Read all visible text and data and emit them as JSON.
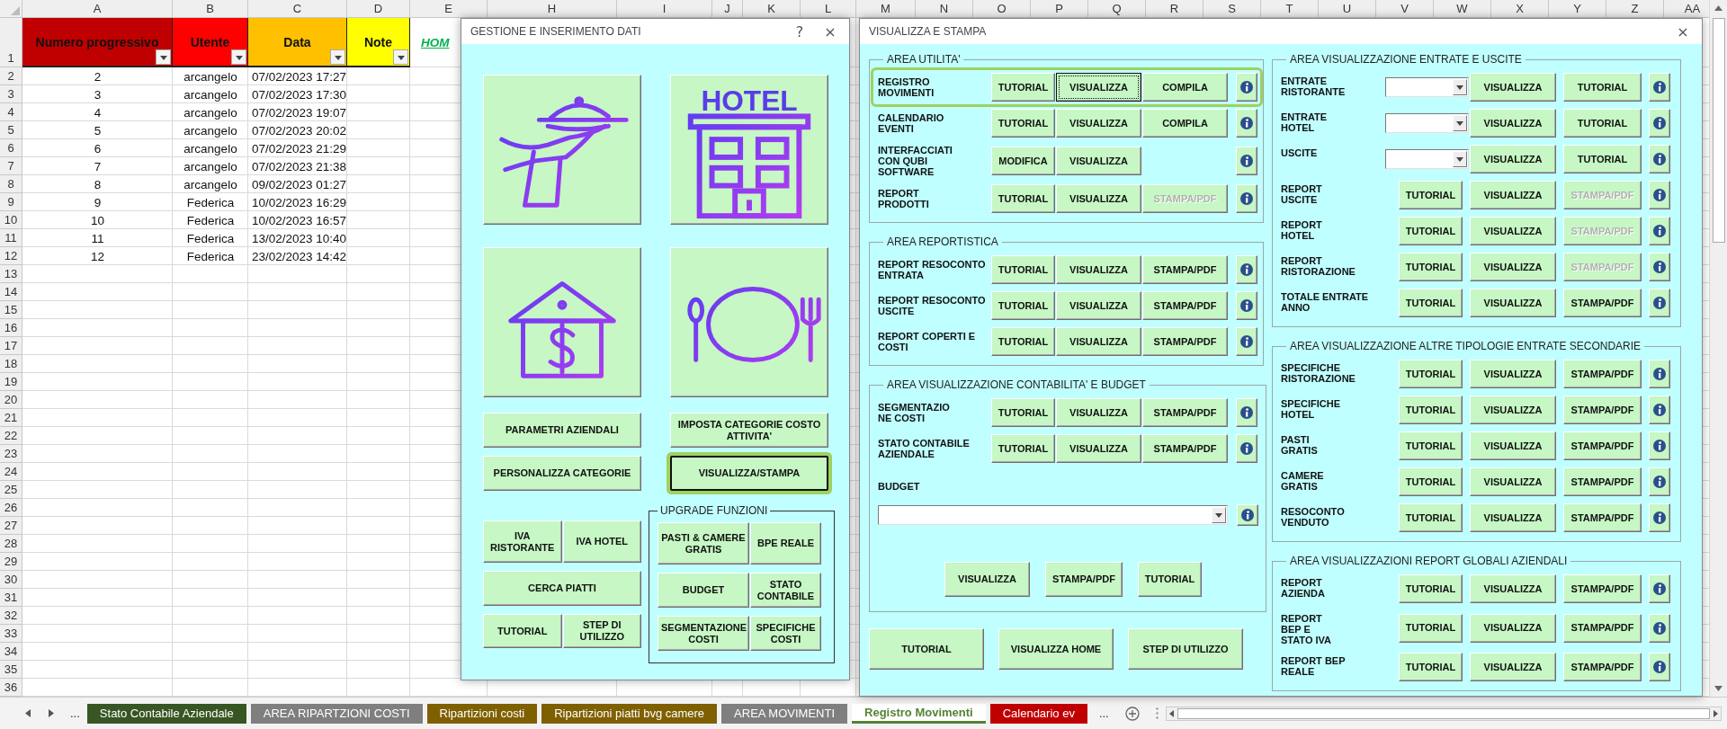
{
  "sheet": {
    "columns": [
      "A",
      "B",
      "C",
      "D",
      "E",
      "H",
      "I",
      "J",
      "K",
      "L",
      "M",
      "N",
      "O",
      "P",
      "Q",
      "R",
      "S",
      "T",
      "U",
      "V",
      "W",
      "X",
      "Y",
      "Z",
      "AA"
    ],
    "row_numbers": [
      "1",
      "2",
      "3",
      "4",
      "5",
      "6",
      "7",
      "8",
      "9",
      "10",
      "11",
      "12",
      "13",
      "14",
      "15",
      "16",
      "17",
      "18",
      "19",
      "20",
      "21",
      "22",
      "23",
      "24",
      "25",
      "26",
      "27",
      "28",
      "29",
      "30",
      "31",
      "32",
      "33",
      "34",
      "35",
      "36"
    ],
    "header": [
      {
        "kind": "filter",
        "text": "Numero progressivo",
        "color": "#c00000"
      },
      {
        "kind": "filter",
        "text": "Utente",
        "color": "#ff0000"
      },
      {
        "kind": "filter",
        "text": "Data",
        "color": "#ffc000"
      },
      {
        "kind": "filter",
        "text": "Note",
        "color": "#ffff00"
      },
      {
        "kind": "link",
        "text": "HOM"
      }
    ],
    "rows": [
      [
        "2",
        "arcangelo",
        "07/02/2023 17:27"
      ],
      [
        "3",
        "arcangelo",
        "07/02/2023 17:30"
      ],
      [
        "4",
        "arcangelo",
        "07/02/2023 19:07"
      ],
      [
        "5",
        "arcangelo",
        "07/02/2023 20:02"
      ],
      [
        "6",
        "arcangelo",
        "07/02/2023 21:29"
      ],
      [
        "7",
        "arcangelo",
        "07/02/2023 21:38"
      ],
      [
        "8",
        "arcangelo",
        "09/02/2023 01:27"
      ],
      [
        "9",
        "Federica",
        "10/02/2023 16:29"
      ],
      [
        "10",
        "Federica",
        "10/02/2023 16:57"
      ],
      [
        "11",
        "Federica",
        "13/02/2023 10:40"
      ],
      [
        "12",
        "Federica",
        "23/02/2023 14:42"
      ]
    ]
  },
  "gestione_dialog": {
    "title": "GESTIONE E INSERIMENTO DATI",
    "help": "?",
    "close": "×",
    "hotel_sign": "HOTEL",
    "main_buttons": [
      {
        "label": "PARAMETRI AZIENDALI",
        "focused": false
      },
      {
        "label": "IMPOSTA CATEGORIE COSTO ATTIVITA'",
        "focused": false
      },
      {
        "label": "PERSONALIZZA CATEGORIE",
        "focused": false
      },
      {
        "label": "VISUALIZZA/STAMPA",
        "focused": true
      }
    ],
    "left_buttons": [
      [
        "IVA RISTORANTE",
        "IVA HOTEL"
      ],
      [
        "CERCA PIATTI"
      ],
      [
        "TUTORIAL",
        "STEP DI UTILIZZO"
      ]
    ],
    "upgrade": {
      "legend": "UPGRADE FUNZIONI",
      "rows": [
        [
          "PASTI & CAMERE GRATIS",
          "BPE REALE"
        ],
        [
          "BUDGET",
          "STATO CONTABILE"
        ],
        [
          "SEGMENTAZIONE COSTI",
          "SPECIFICHE COSTI"
        ]
      ]
    }
  },
  "visualizza_dialog": {
    "title": "VISUALIZZA E STAMPA",
    "close": "×",
    "left_groups": [
      {
        "legend": "AREA UTILITA'",
        "rows": [
          {
            "label": "REGISTRO\nMOVIMENTI",
            "highlighted": true,
            "buttons": [
              {
                "label": "TUTORIAL",
                "disabled": false,
                "focused": false
              },
              {
                "label": "VISUALIZZA",
                "disabled": false,
                "focused": true
              },
              {
                "label": "COMPILA",
                "disabled": false,
                "focused": false
              }
            ]
          },
          {
            "label": "CALENDARIO\nEVENTI",
            "highlighted": false,
            "buttons": [
              {
                "label": "TUTORIAL",
                "disabled": false,
                "focused": false
              },
              {
                "label": "VISUALIZZA",
                "disabled": false,
                "focused": false
              },
              {
                "label": "COMPILA",
                "disabled": false,
                "focused": false
              }
            ]
          },
          {
            "label": "INTERFACCIATI\nCON QUBI\nSOFTWARE",
            "highlighted": false,
            "buttons": [
              {
                "label": "MODIFICA",
                "disabled": false,
                "focused": false
              },
              {
                "label": "VISUALIZZA",
                "disabled": false,
                "focused": false
              }
            ]
          },
          {
            "label": "REPORT\nPRODOTTI",
            "highlighted": false,
            "buttons": [
              {
                "label": "TUTORIAL",
                "disabled": false,
                "focused": false
              },
              {
                "label": "VISUALIZZA",
                "disabled": false,
                "focused": false
              },
              {
                "label": "STAMPA/PDF",
                "disabled": true,
                "focused": false
              }
            ]
          }
        ]
      },
      {
        "legend": "AREA REPORTISTICA",
        "rows": [
          {
            "label": "REPORT RESOCONTO\nENTRATA",
            "highlighted": false,
            "buttons": [
              {
                "label": "TUTORIAL",
                "disabled": false,
                "focused": false
              },
              {
                "label": "VISUALIZZA",
                "disabled": false,
                "focused": false
              },
              {
                "label": "STAMPA/PDF",
                "disabled": false,
                "focused": false
              }
            ]
          },
          {
            "label": "REPORT RESOCONTO\nUSCITE",
            "highlighted": false,
            "buttons": [
              {
                "label": "TUTORIAL",
                "disabled": false,
                "focused": false
              },
              {
                "label": "VISUALIZZA",
                "disabled": false,
                "focused": false
              },
              {
                "label": "STAMPA/PDF",
                "disabled": false,
                "focused": false
              }
            ]
          },
          {
            "label": "REPORT COPERTI E\nCOSTI",
            "highlighted": false,
            "buttons": [
              {
                "label": "TUTORIAL",
                "disabled": false,
                "focused": false
              },
              {
                "label": "VISUALIZZA",
                "disabled": false,
                "focused": false
              },
              {
                "label": "STAMPA/PDF",
                "disabled": false,
                "focused": false
              }
            ]
          }
        ]
      },
      {
        "legend": "AREA VISUALIZZAZIONE CONTABILITA' E BUDGET",
        "rows": [
          {
            "label": "SEGMENTAZIO\nNE COSTI",
            "highlighted": false,
            "buttons": [
              {
                "label": "TUTORIAL",
                "disabled": false,
                "focused": false
              },
              {
                "label": "VISUALIZZA",
                "disabled": false,
                "focused": false
              },
              {
                "label": "STAMPA/PDF",
                "disabled": false,
                "focused": false
              }
            ]
          },
          {
            "label": "STATO CONTABILE\nAZIENDALE",
            "highlighted": false,
            "buttons": [
              {
                "label": "TUTORIAL",
                "disabled": false,
                "focused": false
              },
              {
                "label": "VISUALIZZA",
                "disabled": false,
                "focused": false
              },
              {
                "label": "STAMPA/PDF",
                "disabled": false,
                "focused": false
              }
            ]
          }
        ],
        "budget": {
          "label": "BUDGET",
          "buttons": [
            "VISUALIZZA",
            "STAMPA/PDF",
            "TUTORIAL"
          ]
        }
      }
    ],
    "footer_buttons": [
      "TUTORIAL",
      "VISUALIZZA HOME",
      "STEP DI UTILIZZO"
    ],
    "right_groups": [
      {
        "legend": "AREA VISUALIZZAZIONE ENTRATE E USCITE",
        "rows": [
          {
            "kind": "dropdown",
            "label": "ENTRATE\nRISTORANTE",
            "buttons": [
              {
                "label": "VISUALIZZA",
                "disabled": false
              },
              {
                "label": "TUTORIAL",
                "disabled": false
              }
            ]
          },
          {
            "kind": "dropdown",
            "label": "ENTRATE\nHOTEL",
            "buttons": [
              {
                "label": "VISUALIZZA",
                "disabled": false
              },
              {
                "label": "TUTORIAL",
                "disabled": false
              }
            ]
          },
          {
            "kind": "dropdown",
            "label": "USCITE",
            "buttons": [
              {
                "label": "VISUALIZZA",
                "disabled": false
              },
              {
                "label": "TUTORIAL",
                "disabled": false
              }
            ]
          },
          {
            "kind": "buttons",
            "label": "REPORT\nUSCITE",
            "buttons": [
              {
                "label": "TUTORIAL",
                "disabled": false
              },
              {
                "label": "VISUALIZZA",
                "disabled": false
              },
              {
                "label": "STAMPA/PDF",
                "disabled": true
              }
            ]
          },
          {
            "kind": "buttons",
            "label": "REPORT\nHOTEL",
            "buttons": [
              {
                "label": "TUTORIAL",
                "disabled": false
              },
              {
                "label": "VISUALIZZA",
                "disabled": false
              },
              {
                "label": "STAMPA/PDF",
                "disabled": true
              }
            ]
          },
          {
            "kind": "buttons",
            "label": "REPORT\nRISTORAZIONE",
            "buttons": [
              {
                "label": "TUTORIAL",
                "disabled": false
              },
              {
                "label": "VISUALIZZA",
                "disabled": false
              },
              {
                "label": "STAMPA/PDF",
                "disabled": true
              }
            ]
          },
          {
            "kind": "buttons",
            "label": "TOTALE ENTRATE\nANNO",
            "buttons": [
              {
                "label": "TUTORIAL",
                "disabled": false
              },
              {
                "label": "VISUALIZZA",
                "disabled": false
              },
              {
                "label": "STAMPA/PDF",
                "disabled": false
              }
            ]
          }
        ]
      },
      {
        "legend": "AREA VISUALIZZAZIONE ALTRE TIPOLOGIE ENTRATE SECONDARIE",
        "rows": [
          {
            "kind": "buttons",
            "label": "SPECIFICHE\nRISTORAZIONE",
            "buttons": [
              {
                "label": "TUTORIAL",
                "disabled": false
              },
              {
                "label": "VISUALIZZA",
                "disabled": false
              },
              {
                "label": "STAMPA/PDF",
                "disabled": false
              }
            ]
          },
          {
            "kind": "buttons",
            "label": "SPECIFICHE\nHOTEL",
            "buttons": [
              {
                "label": "TUTORIAL",
                "disabled": false
              },
              {
                "label": "VISUALIZZA",
                "disabled": false
              },
              {
                "label": "STAMPA/PDF",
                "disabled": false
              }
            ]
          },
          {
            "kind": "buttons",
            "label": "PASTI\nGRATIS",
            "buttons": [
              {
                "label": "TUTORIAL",
                "disabled": false
              },
              {
                "label": "VISUALIZZA",
                "disabled": false
              },
              {
                "label": "STAMPA/PDF",
                "disabled": false
              }
            ]
          },
          {
            "kind": "buttons",
            "label": "CAMERE\nGRATIS",
            "buttons": [
              {
                "label": "TUTORIAL",
                "disabled": false
              },
              {
                "label": "VISUALIZZA",
                "disabled": false
              },
              {
                "label": "STAMPA/PDF",
                "disabled": false
              }
            ]
          },
          {
            "kind": "buttons",
            "label": "RESOCONTO\nVENDUTO",
            "buttons": [
              {
                "label": "TUTORIAL",
                "disabled": false
              },
              {
                "label": "VISUALIZZA",
                "disabled": false
              },
              {
                "label": "STAMPA/PDF",
                "disabled": false
              }
            ]
          }
        ]
      },
      {
        "legend": "AREA VISUALIZZAZIONI REPORT GLOBALI AZIENDALI",
        "rows": [
          {
            "kind": "buttons",
            "label": "REPORT\nAZIENDA",
            "buttons": [
              {
                "label": "TUTORIAL",
                "disabled": false
              },
              {
                "label": "VISUALIZZA",
                "disabled": false
              },
              {
                "label": "STAMPA/PDF",
                "disabled": false
              }
            ]
          },
          {
            "kind": "buttons",
            "label": "REPORT\nBEP E\nSTATO IVA",
            "buttons": [
              {
                "label": "TUTORIAL",
                "disabled": false
              },
              {
                "label": "VISUALIZZA",
                "disabled": false
              },
              {
                "label": "STAMPA/PDF",
                "disabled": false
              }
            ]
          },
          {
            "kind": "buttons",
            "label": "REPORT BEP\nREALE",
            "buttons": [
              {
                "label": "TUTORIAL",
                "disabled": false
              },
              {
                "label": "VISUALIZZA",
                "disabled": false
              },
              {
                "label": "STAMPA/PDF",
                "disabled": false
              }
            ]
          }
        ]
      }
    ]
  },
  "sheet_tabs": {
    "more_left": "...",
    "more_right": "...",
    "tabs": [
      {
        "label": "Stato Contabile Aziendale",
        "color": "#375623",
        "selected": false
      },
      {
        "label": "AREA RIPARTZIONI COSTI",
        "color": "#7f7f7f",
        "selected": false
      },
      {
        "label": "Ripartizioni costi",
        "color": "#7f6000",
        "selected": false
      },
      {
        "label": "Ripartizioni piatti bvg camere",
        "color": "#7f6000",
        "selected": false
      },
      {
        "label": "AREA MOVIMENTI",
        "color": "#7f7f7f",
        "selected": false
      },
      {
        "label": "Registro Movimenti",
        "color": "#548235",
        "selected": true
      },
      {
        "label": "Calendario ev",
        "color": "#c00000",
        "selected": false
      }
    ]
  }
}
